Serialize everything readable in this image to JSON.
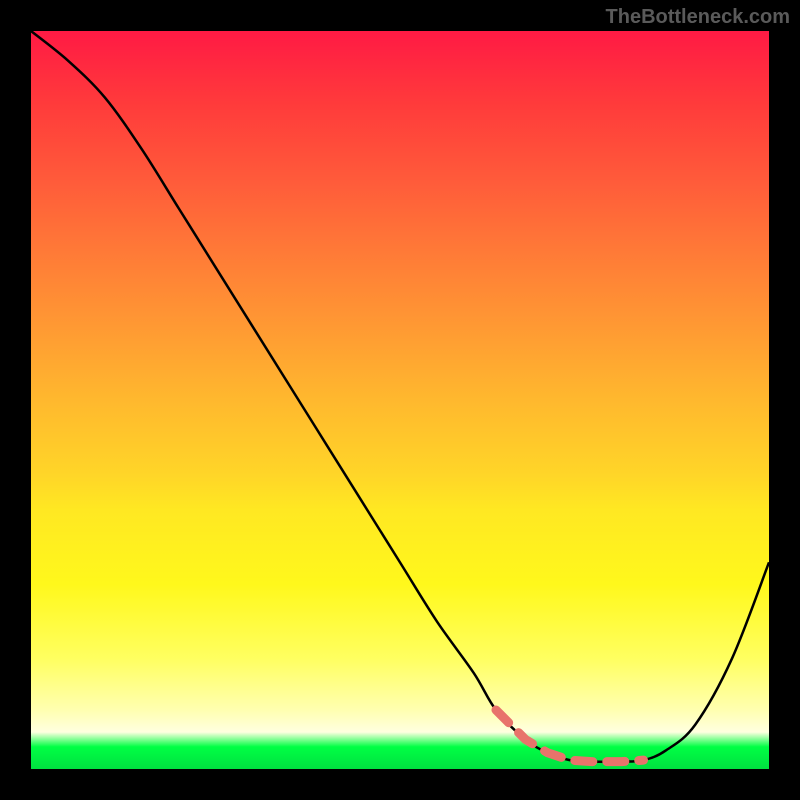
{
  "watermark": "TheBottleneck.com",
  "chart_data": {
    "type": "line",
    "title": "",
    "xlabel": "",
    "ylabel": "",
    "xlim": [
      0,
      100
    ],
    "ylim": [
      0,
      100
    ],
    "series": [
      {
        "name": "curve",
        "x": [
          0,
          5,
          10,
          15,
          20,
          25,
          30,
          35,
          40,
          45,
          50,
          55,
          60,
          63,
          67,
          70,
          73,
          76,
          80,
          83,
          86,
          90,
          95,
          100
        ],
        "values": [
          100,
          96,
          91,
          84,
          76,
          68,
          60,
          52,
          44,
          36,
          28,
          20,
          13,
          8,
          4,
          2.2,
          1.2,
          1.0,
          1.0,
          1.2,
          2.5,
          6,
          15,
          28
        ]
      }
    ],
    "valley_range_x": [
      63,
      84
    ],
    "gradient_stops": [
      {
        "pct": 0,
        "color": "#ff1a44"
      },
      {
        "pct": 50,
        "color": "#ffb82e"
      },
      {
        "pct": 85,
        "color": "#ffff60"
      },
      {
        "pct": 97,
        "color": "#00ff44"
      },
      {
        "pct": 100,
        "color": "#00e040"
      }
    ]
  }
}
